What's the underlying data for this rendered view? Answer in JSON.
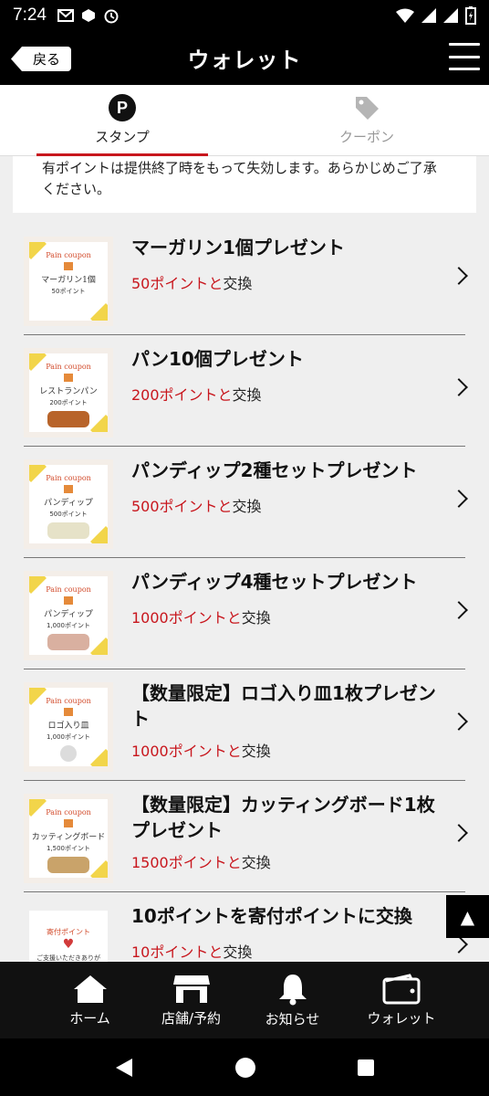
{
  "status_bar": {
    "time": "7:24"
  },
  "header": {
    "back_label": "戻る",
    "title": "ウォレット"
  },
  "tabs": [
    {
      "label": "スタンプ",
      "icon": "p-icon",
      "active": true
    },
    {
      "label": "クーポン",
      "icon": "tag-icon",
      "active": false
    }
  ],
  "notice": {
    "text": "有ポイントは提供終了時をもって失効します。あらかじめご了承ください。"
  },
  "items": [
    {
      "title": "マーガリン1個プレゼント",
      "points": "50ポイントと",
      "exchange": "交換",
      "thumb_name": "マーガリン1個",
      "thumb_points": "50ポイント"
    },
    {
      "title": "パン10個プレゼント",
      "points": "200ポイントと",
      "exchange": "交換",
      "thumb_name": "レストランパン",
      "thumb_points": "200ポイント"
    },
    {
      "title": "パンディップ2種セットプレゼント",
      "points": "500ポイントと",
      "exchange": "交換",
      "thumb_name": "パンディップ",
      "thumb_points": "500ポイント"
    },
    {
      "title": "パンディップ4種セットプレゼント",
      "points": "1000ポイントと",
      "exchange": "交換",
      "thumb_name": "パンディップ",
      "thumb_points": "1,000ポイント"
    },
    {
      "title": "【数量限定】ロゴ入り皿1枚プレゼント",
      "points": "1000ポイントと",
      "exchange": "交換",
      "thumb_name": "ロゴ入り皿",
      "thumb_points": "1,000ポイント"
    },
    {
      "title": "【数量限定】カッティングボード1枚プレゼント",
      "points": "1500ポイントと",
      "exchange": "交換",
      "thumb_name": "カッティングボード",
      "thumb_points": "1,500ポイント"
    },
    {
      "title": "10ポイントを寄付ポイントに交換",
      "points": "10ポイントと",
      "exchange": "交換",
      "thumb_name": "寄付ポイント",
      "thumb_points": "ご支援いただきありがとうございます"
    }
  ],
  "thumb_brand": "Pain coupon",
  "to_top": "▲",
  "bottom_nav": [
    {
      "label": "ホーム",
      "icon": "home-icon"
    },
    {
      "label": "店舗/予約",
      "icon": "store-icon"
    },
    {
      "label": "お知らせ",
      "icon": "bell-icon"
    },
    {
      "label": "ウォレット",
      "icon": "wallet-icon"
    }
  ],
  "colors": {
    "accent": "#c8161d",
    "header_bg": "#000000",
    "thumb_corner": "#f2d54a"
  }
}
